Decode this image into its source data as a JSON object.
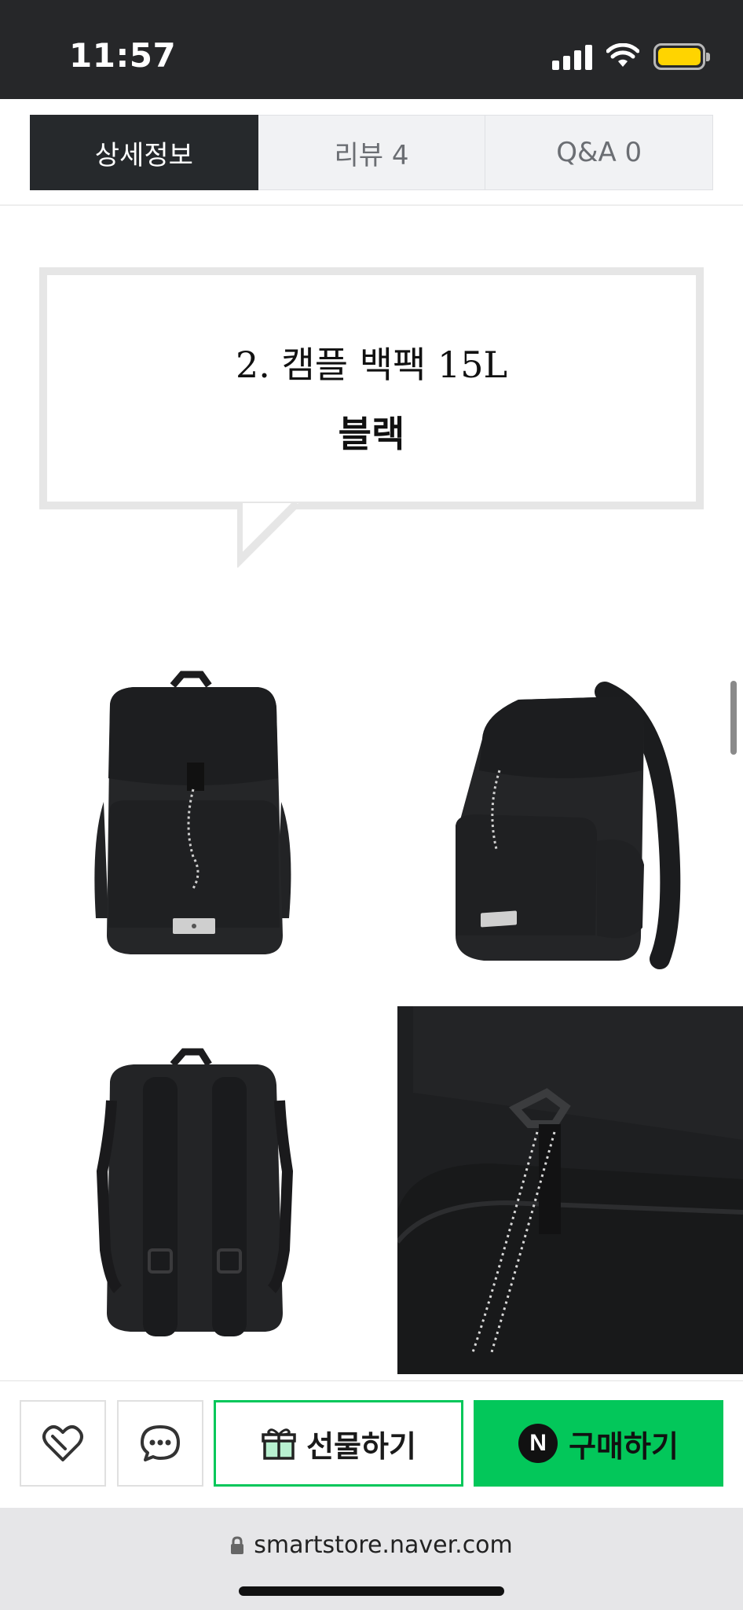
{
  "status_bar": {
    "time": "11:57",
    "battery_color": "#ffd400"
  },
  "tabs": [
    {
      "label": "상세정보",
      "active": true
    },
    {
      "label": "리뷰  4",
      "active": false
    },
    {
      "label": "Q&A  0",
      "active": false
    }
  ],
  "detail": {
    "title": "2. 캠플 백팩 15L",
    "color_name": "블랙"
  },
  "product_images": [
    {
      "name": "backpack-front-image"
    },
    {
      "name": "backpack-side-image"
    },
    {
      "name": "backpack-back-image"
    },
    {
      "name": "backpack-detail-closeup-image"
    }
  ],
  "action_bar": {
    "like_icon": "heart-icon",
    "talk_icon": "chat-bubble-icon",
    "gift_label": "선물하기",
    "gift_icon": "gift-icon",
    "buy_label": "구매하기",
    "npay_badge": "N",
    "accent_color": "#03c75a"
  },
  "browser": {
    "url": "smartstore.naver.com",
    "lock_icon": "lock-icon"
  }
}
